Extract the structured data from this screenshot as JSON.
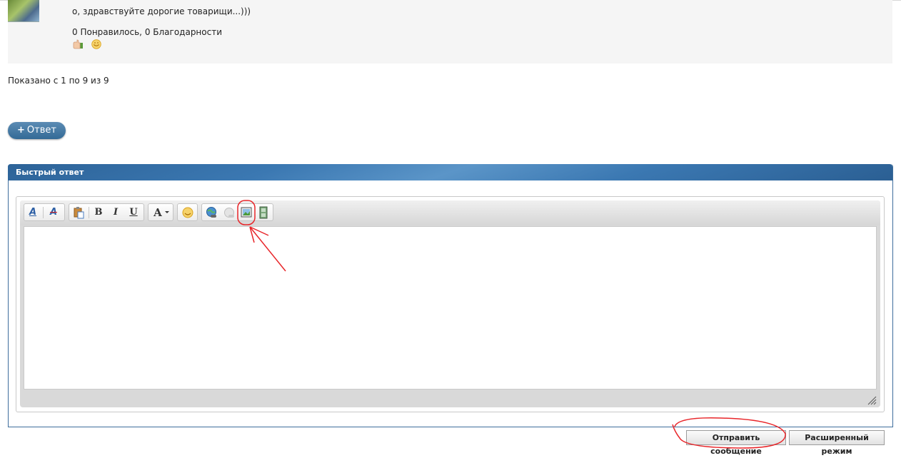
{
  "post": {
    "text": "о, здравствуйте дорогие товарищи...)))",
    "reactions": "0 Понравилось, 0 Благодарности"
  },
  "pagination": "Показано с 1 по 9 из 9",
  "reply_button": {
    "plus": "+",
    "label": "Ответ"
  },
  "quick_reply": {
    "title": "Быстрый ответ",
    "toolbar": {
      "font_color": "A",
      "remove_format": "A",
      "bold": "B",
      "italic": "I",
      "underline": "U",
      "font": "A"
    }
  },
  "buttons": {
    "submit": "Отправить сообщение",
    "advanced": "Расширенный режим"
  },
  "colors": {
    "header_blue": "#3b78b2",
    "reply_button": "#4a7ca6",
    "annotation_red": "#e8262a"
  }
}
